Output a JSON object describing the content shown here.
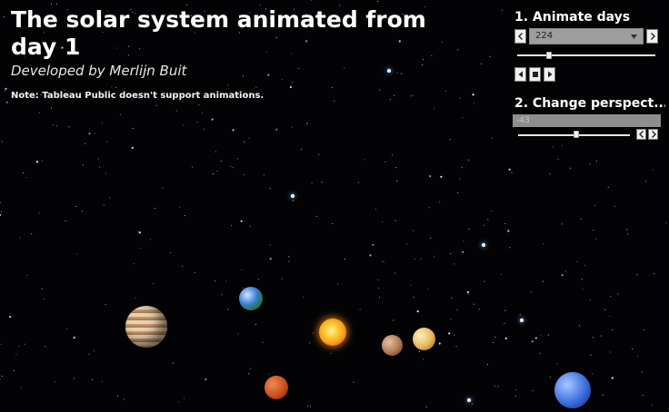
{
  "header": {
    "title": "The solar system animated from day 1",
    "subtitle": "Developed by Merlijn Buit",
    "note": "Note: Tableau Public doesn't support animations."
  },
  "animate_days": {
    "title": "1. Animate days",
    "selected_value": "224",
    "slider_fraction": 0.23
  },
  "perspective": {
    "title": "2. Change perspect...",
    "value": "-43",
    "slider_fraction": 0.52
  },
  "icons": {
    "prev": "chevron-left-icon",
    "next": "chevron-right-icon",
    "dropdown": "chevron-down-icon",
    "play_back": "play-backward-icon",
    "stop": "stop-icon",
    "play": "play-icon"
  },
  "colors": {
    "background": "#030305",
    "sun": "#f5a019",
    "earth": "#3a7bd5",
    "jupiter": "#c9a27a",
    "mars": "#c8501e",
    "venus": "#e6b65a",
    "mercury": "#b07a55",
    "neptune": "#3b6fe0"
  }
}
